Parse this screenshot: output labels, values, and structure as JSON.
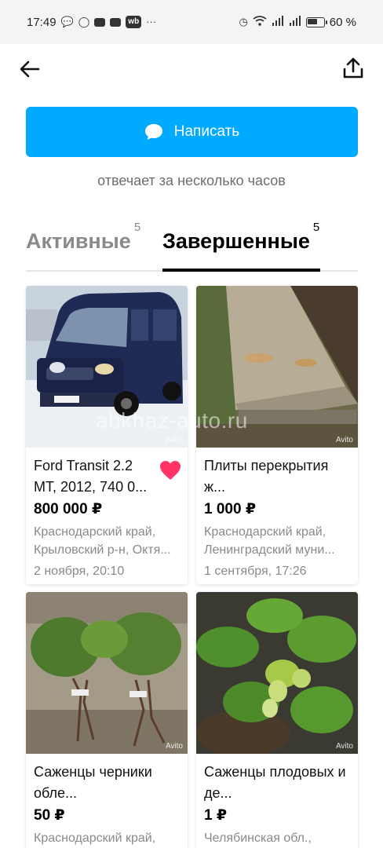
{
  "status_bar": {
    "time": "17:49",
    "battery": "60 %"
  },
  "header": {
    "back_icon": "arrow-left-icon",
    "share_icon": "share-icon"
  },
  "write_button": {
    "label": "Написать",
    "icon": "chat-bubble-icon",
    "color": "#00aaff"
  },
  "reply_note": "отвечает за несколько часов",
  "tabs": [
    {
      "label": "Активные",
      "count": "5",
      "active": false
    },
    {
      "label": "Завершенные",
      "count": "5",
      "active": true
    }
  ],
  "listings": [
    {
      "title": "Ford Transit 2.2 MT, 2012, 740 0...",
      "price": "800 000 ₽",
      "location_lines": [
        "Краснодарский край,",
        "Крыловский р-н, Октя..."
      ],
      "date": "2 ноября, 20:10",
      "favorite": true
    },
    {
      "title": "Плиты перекрытия ж...",
      "price": "1 000 ₽",
      "location_lines": [
        "Краснодарский край,",
        "Ленинградский муни..."
      ],
      "date": "1 сентября, 17:26",
      "favorite": false
    },
    {
      "title": "Саженцы черники обле...",
      "price": "50 ₽",
      "location_lines": [
        "Краснодарский край,"
      ],
      "date": "",
      "favorite": false
    },
    {
      "title": "Саженцы плодовых и де...",
      "price": "1 ₽",
      "location_lines": [
        "Челябинская обл.,"
      ],
      "date": "",
      "favorite": false
    }
  ],
  "image_marks": {
    "avito": "Avito",
    "watermark": "abkhaz-auto.ru"
  },
  "colors": {
    "accent": "#00aaff",
    "favorite": "#ff3366"
  }
}
